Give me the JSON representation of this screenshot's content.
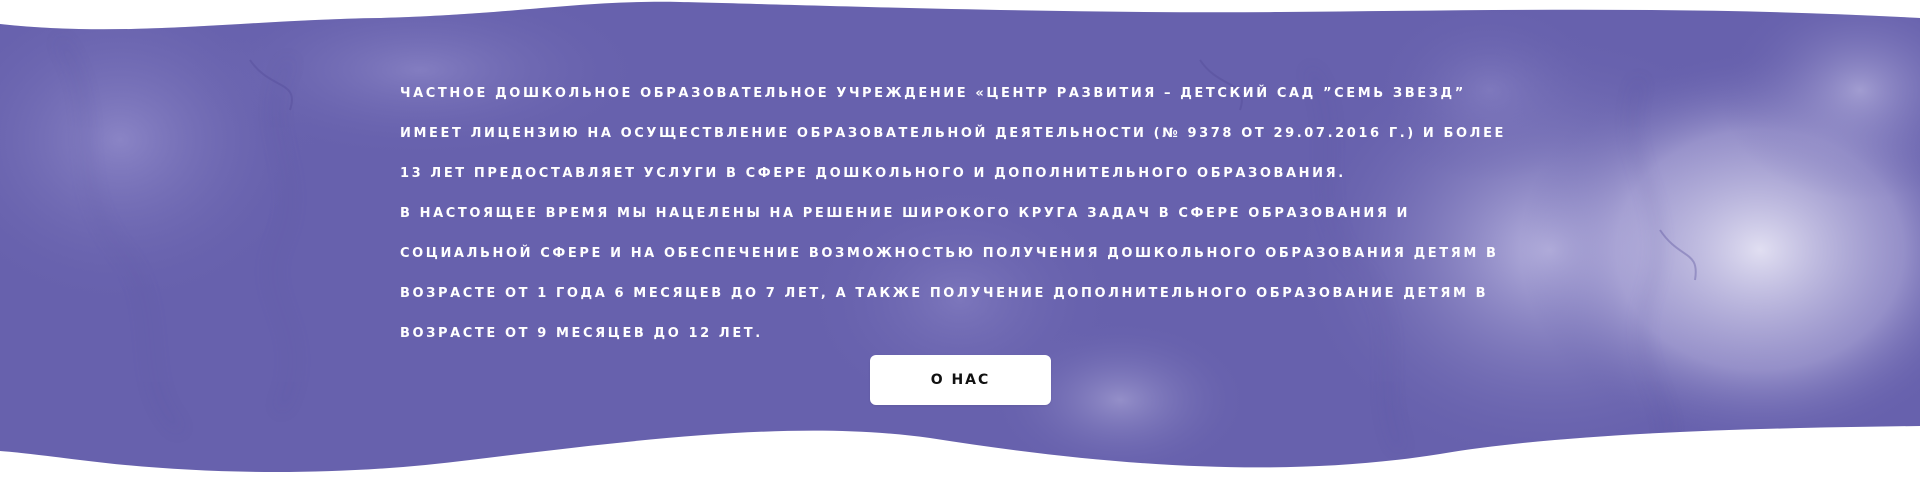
{
  "colors": {
    "background_base": "#6761ad",
    "background_light": "#d9d6ee",
    "text": "#ffffff",
    "button_bg": "#ffffff",
    "button_text": "#111111"
  },
  "about": {
    "paragraph_1": "ЧАСТНОЕ ДОШКОЛЬНОЕ ОБРАЗОВАТЕЛЬНОЕ УЧРЕЖДЕНИЕ «ЦЕНТР РАЗВИТИЯ – ДЕТСКИЙ САД ”СЕМЬ ЗВЕЗД” ИМЕЕТ ЛИЦЕНЗИЮ НА ОСУЩЕСТВЛЕНИЕ ОБРАЗОВАТЕЛЬНОЙ ДЕЯТЕЛЬНОСТИ (№ 9378 ОТ 29.07.2016 Г.) И БОЛЕЕ 13 ЛЕТ ПРЕДОСТАВЛЯЕТ УСЛУГИ В СФЕРЕ ДОШКОЛЬНОГО И ДОПОЛНИТЕЛЬНОГО ОБРАЗОВАНИЯ.",
    "paragraph_2": "В НАСТОЯЩЕЕ ВРЕМЯ МЫ НАЦЕЛЕНЫ НА РЕШЕНИЕ ШИРОКОГО КРУГА ЗАДАЧ В СФЕРЕ ОБРАЗОВАНИЯ И СОЦИАЛЬНОЙ СФЕРЕ И НА ОБЕСПЕЧЕНИЕ ВОЗМОЖНОСТЬЮ ПОЛУЧЕНИЯ ДОШКОЛЬНОГО ОБРАЗОВАНИЯ ДЕТЯМ В ВОЗРАСТЕ ОТ 1 ГОДА 6 МЕСЯЦЕВ ДО 7 ЛЕТ, А ТАКЖЕ ПОЛУЧЕНИЕ ДОПОЛНИТЕЛЬНОГО ОБРАЗОВАНИЕ ДЕТЯМ В ВОЗРАСТЕ ОТ 9 МЕСЯЦЕВ ДО 12 ЛЕТ.",
    "button_label": "О НАС"
  }
}
